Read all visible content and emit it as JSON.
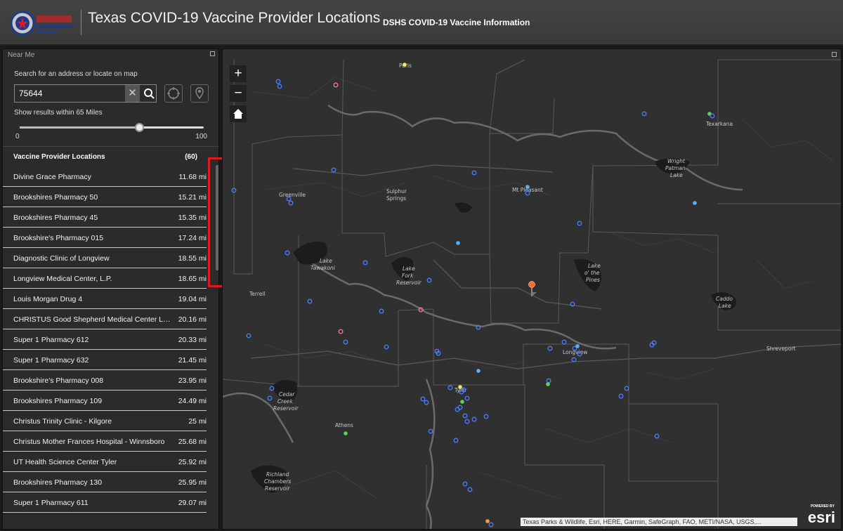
{
  "header": {
    "logo_text": "DSHS",
    "title": "Texas COVID-19 Vaccine Provider Locations",
    "link": "DSHS COVID-19 Vaccine Information"
  },
  "panel": {
    "title": "Near Me",
    "search_hint": "Search for an address or locate on map",
    "search_value": "75644",
    "radius_label": "Show results within 65 Miles",
    "slider": {
      "min_label": "0",
      "max_label": "100",
      "value": 65
    },
    "list_title": "Vaccine Provider Locations",
    "list_count": "(60)",
    "items": [
      {
        "name": "Divine Grace Pharmacy",
        "dist": "11.68 mi"
      },
      {
        "name": "Brookshires Pharmacy 50",
        "dist": "15.21 mi"
      },
      {
        "name": "Brookshires Pharmacy 45",
        "dist": "15.35 mi"
      },
      {
        "name": "Brookshire's Pharmacy 015",
        "dist": "17.24 mi"
      },
      {
        "name": "Diagnostic Clinic of Longview",
        "dist": "18.55 mi"
      },
      {
        "name": "Longview Medical Center, L.P.",
        "dist": "18.65 mi"
      },
      {
        "name": "Louis Morgan Drug 4",
        "dist": "19.04 mi"
      },
      {
        "name": "CHRISTUS Good Shepherd Medical Center Longview",
        "dist": "20.16 mi"
      },
      {
        "name": "Super 1 Pharmacy 612",
        "dist": "20.33 mi"
      },
      {
        "name": "Super 1 Pharmacy 632",
        "dist": "21.45 mi"
      },
      {
        "name": "Brookshire's Pharmacy 008",
        "dist": "23.95 mi"
      },
      {
        "name": "Brookshires Pharmacy 109",
        "dist": "24.49 mi"
      },
      {
        "name": "Christus Trinity Clinic - Kilgore",
        "dist": "25 mi"
      },
      {
        "name": "Christus Mother Frances Hospital - Winnsboro",
        "dist": "25.68 mi"
      },
      {
        "name": "UT Health Science Center Tyler",
        "dist": "25.92 mi"
      },
      {
        "name": "Brookshires Pharmacy 130",
        "dist": "25.95 mi"
      },
      {
        "name": "Super 1 Pharmacy 611",
        "dist": "29.07 mi"
      }
    ]
  },
  "map": {
    "places": {
      "paris": "Paris",
      "texarkana": "Texarkana",
      "greenville": "Greenville",
      "sulphur1": "Sulphur",
      "sulphur2": "Springs",
      "mtpleasant": "Mt Pleasant",
      "wright1": "Wright",
      "wright2": "Patman",
      "wright3": "Lake",
      "tawakoni1": "Lake",
      "tawakoni2": "Tawakoni",
      "lakefork1": "Lake",
      "lakefork2": "Fork",
      "lakefork3": "Reservoir",
      "pines1": "Lake",
      "pines2": "o' the",
      "pines3": "Pines",
      "caddo1": "Caddo",
      "caddo2": "Lake",
      "terrell": "Terrell",
      "longview": "Longview",
      "shreveport": "Shreveport",
      "tyler": "Tyler",
      "cedar1": "Cedar",
      "cedar2": "Creek",
      "cedar3": "Reservoir",
      "athens": "Athens",
      "richland1": "Richland",
      "richland2": "Chambers",
      "richland3": "Reservoir"
    },
    "attribution": "Texas Parks & Wildlife, Esri, HERE, Garmin, SafeGraph, FAO, METI/NASA, USGS,...",
    "powered_by": "POWERED BY",
    "esri_logo": "esri",
    "colors": {
      "blue": "#4a7bff",
      "lightblue": "#5ab0ff",
      "pink": "#ff6f91",
      "green": "#5fd35a",
      "yellow": "#f5e663",
      "orange": "#ff9a3c",
      "pin": "#ff6a2a"
    }
  }
}
